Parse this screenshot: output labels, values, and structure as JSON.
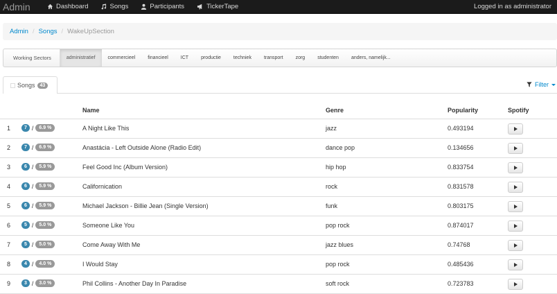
{
  "navbar": {
    "brand": "Admin",
    "items": [
      {
        "label": "Dashboard",
        "icon": "home-icon"
      },
      {
        "label": "Songs",
        "icon": "music-icon"
      },
      {
        "label": "Participants",
        "icon": "user-icon"
      },
      {
        "label": "TickerTape",
        "icon": "bullhorn-icon"
      }
    ],
    "login": "Logged in as administrator"
  },
  "breadcrumb": {
    "items": [
      "Admin",
      "Songs"
    ],
    "active": "WakeUpSection",
    "separator": "/"
  },
  "sectors": {
    "header": "Working Sectors",
    "items": [
      "administratief",
      "commercieel",
      "financieel",
      "ICT",
      "productie",
      "techniek",
      "transport",
      "zorg",
      "studenten",
      "anders, namelijk..."
    ],
    "active_index": 0
  },
  "songs_tab": {
    "label": "Songs",
    "count": "43"
  },
  "filter": {
    "label": "Filter"
  },
  "table": {
    "headers": {
      "name": "Name",
      "genre": "Genre",
      "popularity": "Popularity",
      "spotify": "Spotify"
    },
    "rows": [
      {
        "num": "1",
        "votes": "7",
        "percent": "6.9 %",
        "name": "A Night Like This",
        "genre": "jazz",
        "popularity": "0.493194"
      },
      {
        "num": "2",
        "votes": "7",
        "percent": "6.9 %",
        "name": "Anastácia - Left Outside Alone (Radio Edit)",
        "genre": "dance pop",
        "popularity": "0.134656"
      },
      {
        "num": "3",
        "votes": "6",
        "percent": "5.9 %",
        "name": "Feel Good Inc (Album Version)",
        "genre": "hip hop",
        "popularity": "0.833754"
      },
      {
        "num": "4",
        "votes": "6",
        "percent": "5.9 %",
        "name": "Californication",
        "genre": "rock",
        "popularity": "0.831578"
      },
      {
        "num": "5",
        "votes": "6",
        "percent": "5.9 %",
        "name": "Michael Jackson - Billie Jean (Single Version)",
        "genre": "funk",
        "popularity": "0.803175"
      },
      {
        "num": "6",
        "votes": "5",
        "percent": "5.0 %",
        "name": "Someone Like You",
        "genre": "pop rock",
        "popularity": "0.874017"
      },
      {
        "num": "7",
        "votes": "5",
        "percent": "5.0 %",
        "name": "Come Away With Me",
        "genre": "jazz blues",
        "popularity": "0.74768"
      },
      {
        "num": "8",
        "votes": "4",
        "percent": "4.0 %",
        "name": "I Would Stay",
        "genre": "pop rock",
        "popularity": "0.485436"
      },
      {
        "num": "9",
        "votes": "3",
        "percent": "3.0 %",
        "name": "Phil Collins - Another Day In Paradise",
        "genre": "soft rock",
        "popularity": "0.723783"
      }
    ]
  },
  "colors": {
    "navbar": "#1b1b1b",
    "link": "#0088cc",
    "badge_blue": "#3a87ad",
    "badge_grey": "#999999"
  }
}
